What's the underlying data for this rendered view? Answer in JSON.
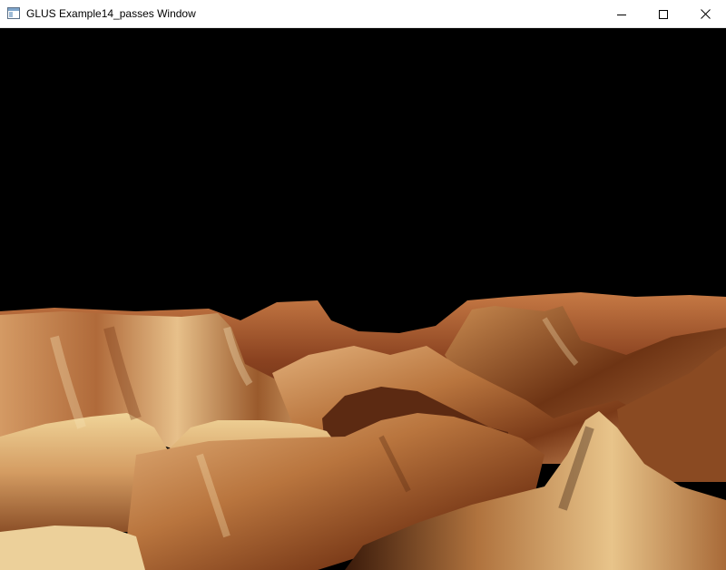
{
  "window": {
    "title": "GLUS Example14_passes Window",
    "icons": {
      "app": "app-window-icon",
      "minimize": "minimize-icon",
      "maximize": "maximize-icon",
      "close": "close-icon"
    }
  },
  "scene": {
    "description_colors": {
      "sky": "#000000",
      "terrain_dark": "#3a1a0a",
      "terrain_mid": "#a35a2a",
      "terrain_light": "#e8c98a"
    }
  }
}
